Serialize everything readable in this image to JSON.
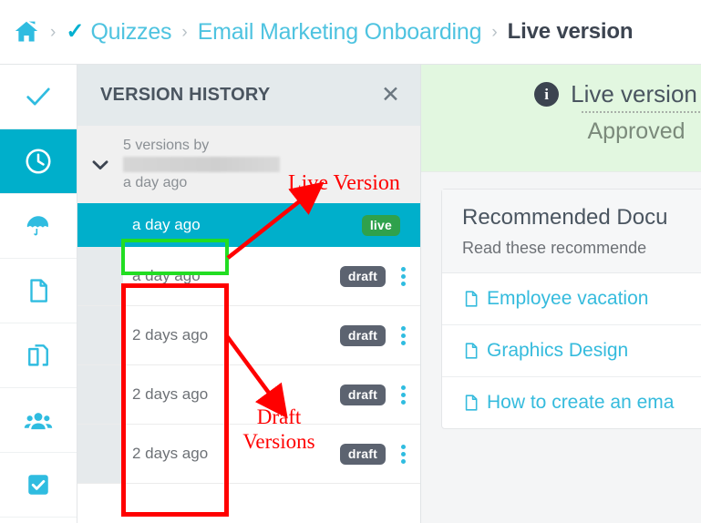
{
  "breadcrumb": {
    "home_icon": "home-icon",
    "items": [
      {
        "label": "Quizzes",
        "icon": "check-icon",
        "active": false
      },
      {
        "label": "Email Marketing Onboarding",
        "active": false
      },
      {
        "label": "Live version",
        "active": true
      }
    ],
    "separator": "›"
  },
  "sidebar": {
    "items": [
      {
        "name": "checkmark-icon",
        "label": "Approvals"
      },
      {
        "name": "clock-icon",
        "label": "Version history"
      },
      {
        "name": "umbrella-icon",
        "label": "Coverage"
      },
      {
        "name": "document-icon",
        "label": "Document"
      },
      {
        "name": "copy-icon",
        "label": "Copies"
      },
      {
        "name": "people-icon",
        "label": "Audience"
      },
      {
        "name": "checkbox-icon",
        "label": "Tasks"
      }
    ]
  },
  "version_panel": {
    "title": "VERSION HISTORY",
    "close_label": "✕",
    "group": {
      "count_text": "5 versions by",
      "author": "",
      "time": "a day ago",
      "chevron": "chevron-down-icon"
    },
    "rows": [
      {
        "time": "a day ago",
        "badge": "live",
        "state": "live",
        "menu": false
      },
      {
        "time": "a day ago",
        "badge": "draft",
        "state": "draft",
        "menu": true
      },
      {
        "time": "2 days ago",
        "badge": "draft",
        "state": "draft",
        "menu": true
      },
      {
        "time": "2 days ago",
        "badge": "draft",
        "state": "draft",
        "menu": true
      },
      {
        "time": "2 days ago",
        "badge": "draft",
        "state": "draft",
        "menu": true
      }
    ]
  },
  "right_pane": {
    "banner": {
      "icon": "info-icon",
      "title": "Live version",
      "subtitle": "Approved"
    },
    "card": {
      "title": "Recommended Docu",
      "subtitle": "Read these recommende",
      "links": [
        {
          "label": "Employee vacation",
          "icon": "file-icon"
        },
        {
          "label": "Graphics Design",
          "icon": "file-icon"
        },
        {
          "label": "How to create an ema",
          "icon": "file-icon"
        }
      ]
    }
  },
  "annotations": {
    "live_version": "Live Version",
    "draft_versions": "Draft Versions"
  },
  "colors": {
    "teal": "#00afcb",
    "link_blue": "#4ec3e0",
    "badge_live_green": "#2fa14c",
    "badge_draft_gray": "#5c6370",
    "banner_green": "#e2f7e0",
    "annotation_red": "#ff0000",
    "highlight_green": "#22dd22",
    "panel_header": "#e4eaec"
  }
}
